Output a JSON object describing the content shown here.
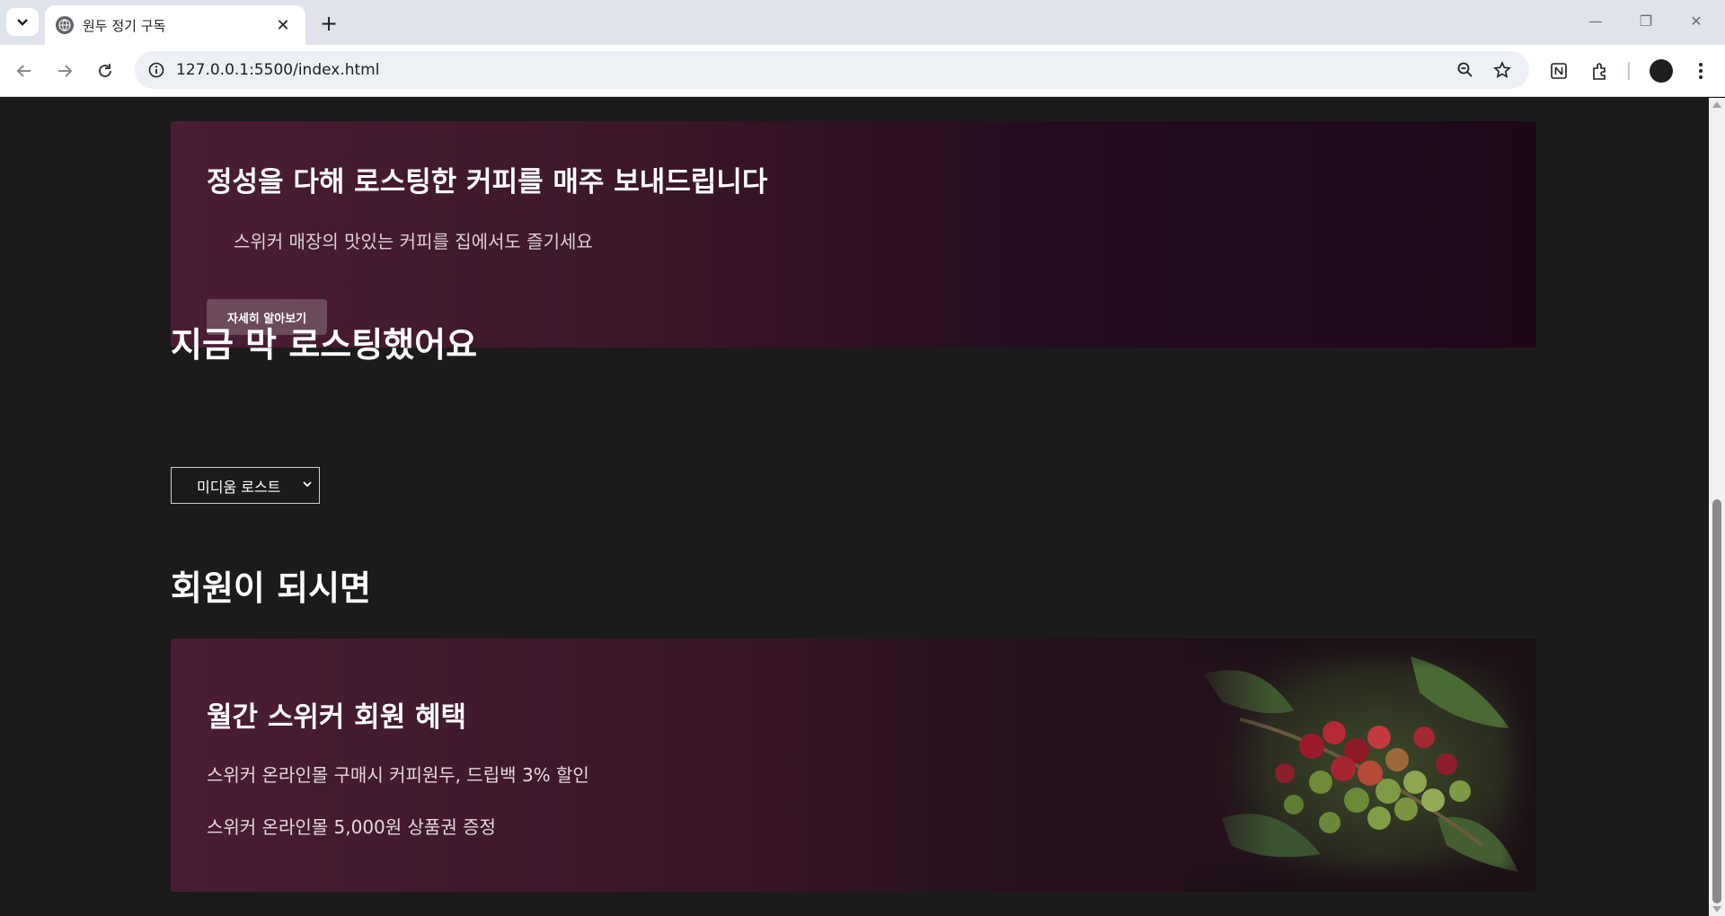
{
  "browser": {
    "tab_title": "원두 정기 구독",
    "url": "127.0.0.1:5500/index.html"
  },
  "hero": {
    "title": "정성을 다해 로스팅한 커피를 매주 보내드립니다",
    "subtitle": "스위커 매장의 맛있는 커피를 집에서도 즐기세요",
    "button_label": "자세히 알아보기"
  },
  "roast_section": {
    "title": "지금 막 로스팅했어요",
    "select_value": "미디움 로스트"
  },
  "member_section": {
    "title": "회원이 되시면",
    "card_title": "월간 스위커 회원 혜택",
    "benefits": [
      "스위커 온라인몰 구매시 커피원두, 드립백 3% 할인",
      "스위커 온라인몰 5,000원 상품권 증정"
    ]
  },
  "colors": {
    "page_background": "#1b1b1b",
    "hero_gradient_start": "#4b1d35",
    "hero_gradient_end": "#1d081a",
    "button_background": "#6b4a5b"
  },
  "icons": [
    "tab-search-icon",
    "globe-icon",
    "close-icon",
    "plus-icon",
    "back-arrow-icon",
    "forward-arrow-icon",
    "reload-icon",
    "site-info-icon",
    "zoom-icon",
    "star-icon",
    "notion-icon",
    "extensions-icon",
    "menu-dots-icon"
  ]
}
